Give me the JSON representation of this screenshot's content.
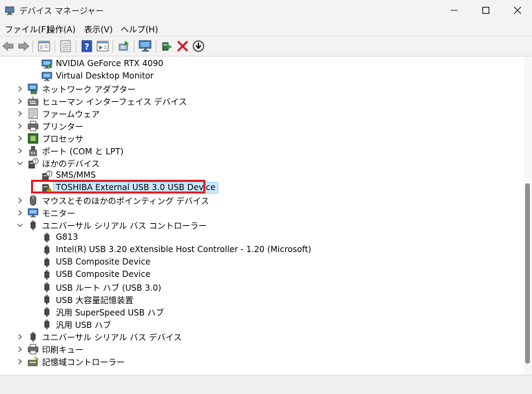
{
  "window": {
    "title": "デバイス マネージャー"
  },
  "menu": [
    "ファイル(F)",
    "操作(A)",
    "表示(V)",
    "ヘルプ(H)"
  ],
  "toolbar": [
    "back-arrow-icon",
    "forward-arrow-icon",
    "properties-icon",
    "device-list-icon",
    "help-icon",
    "details-view-icon",
    "update-driver-icon",
    "monitor-scan-icon",
    "enable-device-icon",
    "uninstall-x-icon",
    "download-circle-icon"
  ],
  "tree": [
    {
      "label": "NVIDIA GeForce RTX 4090",
      "icon": "display-adapter"
    },
    {
      "label": "Virtual Desktop Monitor",
      "icon": "display-adapter"
    },
    {
      "label": "ネットワーク アダプター",
      "icon": "network"
    },
    {
      "label": "ヒューマン インターフェイス デバイス",
      "icon": "hid"
    },
    {
      "label": "ファームウェア",
      "icon": "firmware"
    },
    {
      "label": "プリンター",
      "icon": "printer"
    },
    {
      "label": "プロセッサ",
      "icon": "processor"
    },
    {
      "label": "ポート (COM と LPT)",
      "icon": "port"
    },
    {
      "label": "ほかのデバイス",
      "icon": "other-device"
    },
    {
      "label": "SMS/MMS",
      "icon": "unknown-device"
    },
    {
      "label": "TOSHIBA External USB 3.0 USB Device",
      "icon": "warning-device",
      "selected": true
    },
    {
      "label": "マウスとそのほかのポインティング デバイス",
      "icon": "mouse"
    },
    {
      "label": "モニター",
      "icon": "monitor"
    },
    {
      "label": "ユニバーサル シリアル バス コントローラー",
      "icon": "usb"
    },
    {
      "label": "G813",
      "icon": "usb"
    },
    {
      "label": "Intel(R) USB 3.20 eXtensible Host Controller - 1.20 (Microsoft)",
      "icon": "usb"
    },
    {
      "label": "USB Composite Device",
      "icon": "usb"
    },
    {
      "label": "USB Composite Device",
      "icon": "usb"
    },
    {
      "label": "USB ルート ハブ (USB 3.0)",
      "icon": "usb"
    },
    {
      "label": "USB 大容量記憶装置",
      "icon": "usb"
    },
    {
      "label": "汎用 SuperSpeed USB ハブ",
      "icon": "usb"
    },
    {
      "label": "汎用 USB ハブ",
      "icon": "usb"
    },
    {
      "label": "ユニバーサル シリアル バス デバイス",
      "icon": "usb"
    },
    {
      "label": "印刷キュー",
      "icon": "print-queue"
    },
    {
      "label": "記憶域コントローラー",
      "icon": "storage"
    }
  ]
}
